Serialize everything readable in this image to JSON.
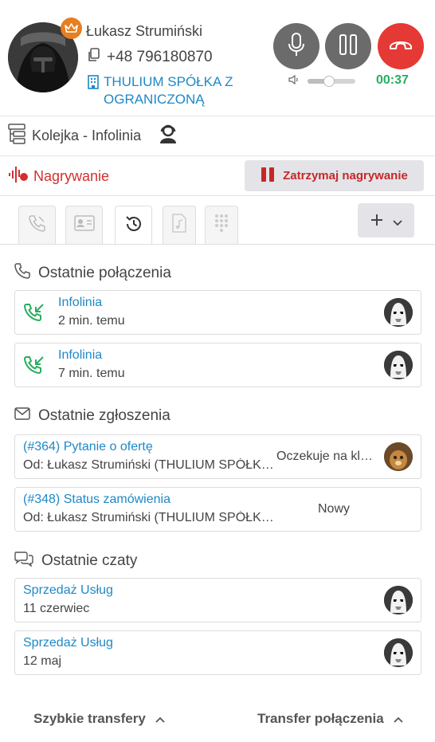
{
  "contact": {
    "name": "Łukasz Strumiński",
    "phone": "+48 796180870",
    "company": "THULIUM SPÓŁKA Z OGRANICZONĄ"
  },
  "call": {
    "timer": "00:37",
    "volume_level": 0.45
  },
  "queue": {
    "label": "Kolejka - Infolinia"
  },
  "recording": {
    "label": "Nagrywanie",
    "stop_label": "Zatrzymaj nagrywanie"
  },
  "colors": {
    "accent": "#1e88c7",
    "hangup": "#e53935",
    "timer": "#27ae60",
    "recording": "#d32f2f",
    "crown": "#e67e22"
  },
  "recent_calls": {
    "title": "Ostatnie połączenia",
    "items": [
      {
        "name": "Infolinia",
        "time": "2 min. temu",
        "icon": "incoming-call-icon",
        "avatar": "stormtrooper-avatar"
      },
      {
        "name": "Infolinia",
        "time": "7 min. temu",
        "icon": "incoming-call-icon",
        "avatar": "stormtrooper-avatar"
      }
    ]
  },
  "recent_tickets": {
    "title": "Ostatnie zgłoszenia",
    "items": [
      {
        "title": "(#364) Pytanie o ofertę",
        "from": "Od: Łukasz Strumiński (THULIUM SPÓŁKA Z OGRANICZONĄ)",
        "status": "Oczekuje na klienta",
        "avatar": "user-avatar"
      },
      {
        "title": "(#348) Status zamówienia",
        "from": "Od: Łukasz Strumiński (THULIUM SPÓŁKA Z OGRANICZONĄ)",
        "status": "Nowy"
      }
    ]
  },
  "recent_chats": {
    "title": "Ostatnie czaty",
    "items": [
      {
        "title": "Sprzedaż Usług",
        "date": "11 czerwiec",
        "avatar": "stormtrooper-avatar"
      },
      {
        "title": "Sprzedaż Usług",
        "date": "12 maj",
        "avatar": "stormtrooper-avatar"
      }
    ]
  },
  "footer": {
    "quick_transfers": "Szybkie transfery",
    "call_transfer": "Transfer połączenia"
  }
}
